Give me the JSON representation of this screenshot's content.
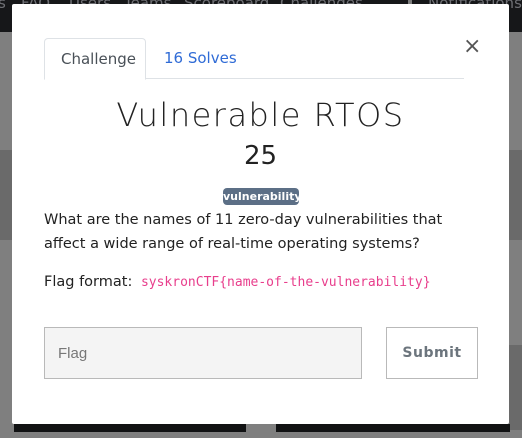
{
  "navbar": {
    "items": [
      "s",
      "FAQ",
      "Users",
      "Teams",
      "Scoreboard",
      "Challenges"
    ],
    "right_item": "Notifications"
  },
  "modal": {
    "tabs": [
      {
        "label": "Challenge",
        "active": true
      },
      {
        "label": "16 Solves",
        "active": false
      }
    ],
    "close_symbol": "×",
    "title": "Vulnerable RTOS",
    "points": "25",
    "tag": "vulnerability",
    "description": "What are the names of 11 zero-day vulnerabilities that affect a wide range of real-time operating systems?",
    "flag_format_label": "Flag format:",
    "flag_format_code": "syskronCTF{name-of-the-vulnerability}",
    "flag_input": {
      "placeholder": "Flag",
      "value": ""
    },
    "submit_label": "Submit"
  },
  "colors": {
    "tab_link": "#2f6bd6",
    "badge_bg": "#5c6f86",
    "code_text": "#e83e8c",
    "overlay": "#7f7f7f"
  }
}
